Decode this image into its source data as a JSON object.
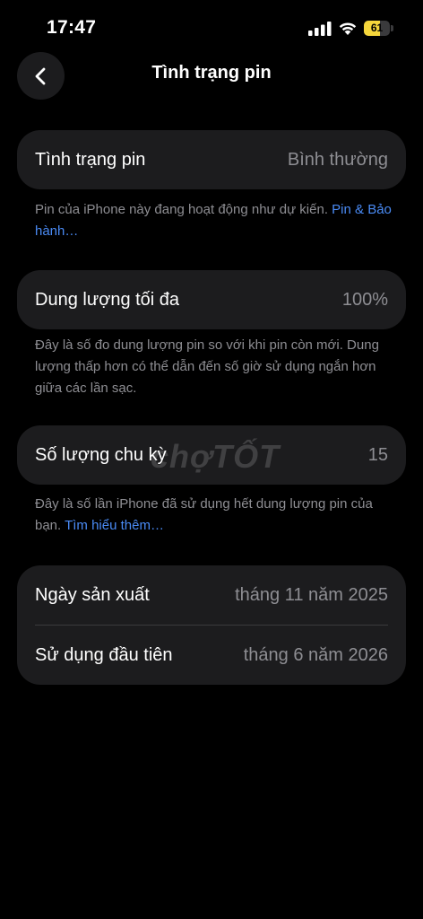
{
  "status_bar": {
    "time": "17:47",
    "battery_percent": "61",
    "battery_level": 0.61
  },
  "nav": {
    "title": "Tình trạng pin"
  },
  "battery_health": {
    "label": "Tình trạng pin",
    "value": "Bình thường",
    "note": "Pin của iPhone này đang hoạt động như dự kiến. ",
    "link": "Pin & Bảo hành…"
  },
  "max_capacity": {
    "label": "Dung lượng tối đa",
    "value": "100%",
    "note": "Đây là số đo dung lượng pin so với khi pin còn mới. Dung lượng thấp hơn có thể dẫn đến số giờ sử dụng ngắn hơn giữa các lần sạc."
  },
  "cycle_count": {
    "label": "Số lượng chu kỳ",
    "value": "15",
    "note": "Đây là số lần iPhone đã sử dụng hết dung lượng pin của bạn. ",
    "link": "Tìm hiểu thêm…"
  },
  "dates": {
    "manufacture_label": "Ngày sản xuất",
    "manufacture_value": "tháng 11 năm 2025",
    "first_use_label": "Sử dụng đầu tiên",
    "first_use_value": "tháng 6 năm 2026"
  },
  "watermark": "chợTỐT",
  "colors": {
    "background": "#000000",
    "card": "#1c1c1e",
    "secondary_text": "#8e8e93",
    "link": "#4a8bf5",
    "battery": "#f5d63b"
  }
}
